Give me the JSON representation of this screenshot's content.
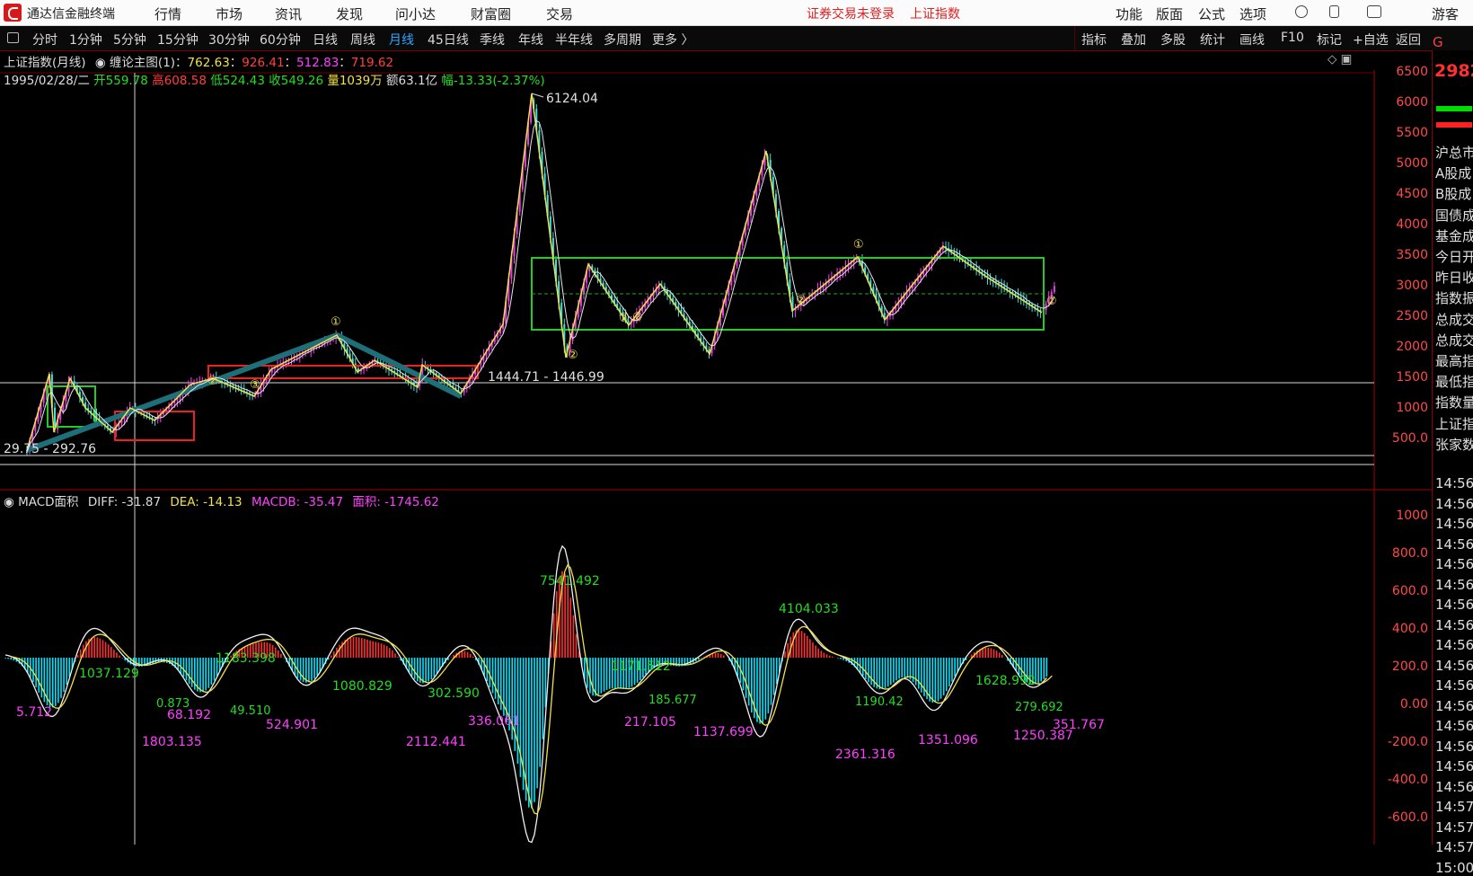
{
  "menubar": {
    "app_title": "通达信金融终端",
    "menus": [
      "行情",
      "市场",
      "资讯",
      "发现",
      "问小达",
      "财富圈",
      "交易"
    ],
    "notice_trade": "证券交易未登录",
    "notice_index": "上证指数",
    "right_menus": [
      "功能",
      "版面",
      "公式",
      "选项"
    ],
    "user": "游客"
  },
  "toolbar": {
    "periods": [
      "分时",
      "1分钟",
      "5分钟",
      "15分钟",
      "30分钟",
      "60分钟",
      "日线",
      "周线",
      "月线",
      "45日线",
      "季线",
      "年线",
      "半年线",
      "多周期",
      "更多 〉"
    ],
    "active_period": "月线",
    "right_items": [
      "指标",
      "叠加",
      "多股",
      "统计",
      "画线",
      "F10",
      "标记",
      "+自选",
      "返回"
    ]
  },
  "main_chart": {
    "title": "上证指数(月线)",
    "indicator_label": "缠论主图(1)：",
    "indicator_values": [
      "762.63",
      "926.41",
      "512.83",
      "719.62"
    ],
    "info_date": "1995/02/28/二",
    "info_open": "开559.78",
    "info_high": "高608.58",
    "info_low": "低524.43",
    "info_close": "收549.26",
    "info_vol": "量1039万",
    "info_amount": "额63.1亿",
    "info_change": "幅-13.33(-2.37%)",
    "peak_label": "6124.04",
    "support_label": "1444.71 - 1446.99",
    "bottom_label": "29.75 - 292.76",
    "stroke_marks": [
      "①",
      "②",
      "③",
      "②",
      "②",
      "②",
      "②",
      "①",
      "②"
    ]
  },
  "macd": {
    "label": "MACD面积",
    "diff": "DIFF: -31.87",
    "dea": "DEA: -14.13",
    "macdb": "MACDB: -35.47",
    "area": "面积: -1745.62",
    "pos_labels": [
      "1037.129",
      "1183.398",
      "1080.829",
      "302.590",
      "7541.492",
      "1171.512",
      "4104.033",
      "1628.992",
      "0.873",
      "49.510",
      "185.677",
      "1190.42",
      "279.692"
    ],
    "neg_labels": [
      "5.712",
      "1803.135",
      "68.192",
      "524.901",
      "2112.441",
      "336.061",
      "217.105",
      "1137.699",
      "2361.316",
      "1351.096",
      "1250.387",
      "351.767"
    ]
  },
  "axis": {
    "main_ticks": [
      "6500",
      "6000",
      "5500",
      "5000",
      "4500",
      "4000",
      "3500",
      "3000",
      "2500",
      "2000",
      "1500",
      "1000",
      "500.0"
    ],
    "macd_ticks": [
      "1000",
      "800.0",
      "600.0",
      "400.0",
      "200.0",
      "0.00",
      "-200.0",
      "-400.0",
      "-600.0"
    ]
  },
  "right_panel": {
    "top_digit": "G",
    "price": "2982",
    "items": [
      "沪总市",
      "A股成",
      "B股成",
      "国债成",
      "基金成",
      "今日开",
      "昨日收",
      "指数振",
      "总成交",
      "总成交",
      "最高指",
      "最低指",
      "指数量",
      "上证指",
      "张家数"
    ],
    "times": [
      "14:56",
      "14:56",
      "14:56",
      "14:56",
      "14:56",
      "14:56",
      "14:56",
      "14:56",
      "14:56",
      "14:56",
      "14:56",
      "14:56",
      "14:56",
      "14:56",
      "14:56",
      "14:56",
      "14:57",
      "14:57",
      "14:57",
      "15:00"
    ]
  },
  "colors": {
    "up": "#ff3030",
    "down": "#00ffff",
    "ma": "#f2e14a",
    "frame": "#22bb22",
    "axis_line": "#aa0000",
    "stroke_line": "#1f6f78"
  }
}
